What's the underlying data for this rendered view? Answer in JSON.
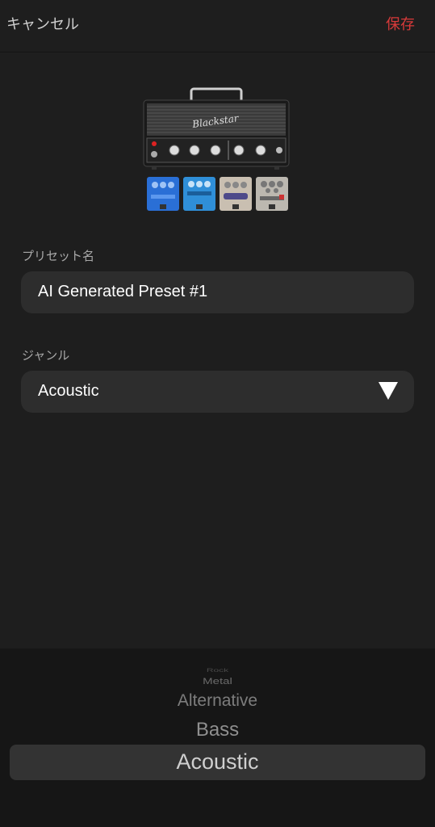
{
  "header": {
    "cancel_label": "キャンセル",
    "save_label": "保存"
  },
  "preset_name": {
    "label": "プリセット名",
    "value": "AI Generated Preset #1"
  },
  "genre": {
    "label": "ジャンル",
    "selected": "Acoustic"
  },
  "picker": {
    "items": [
      "Rock",
      "Metal",
      "Alternative",
      "Bass",
      "Acoustic"
    ]
  },
  "rig": {
    "amp_logo": "Blackstar",
    "pedals": [
      "SUSTAINER",
      "Digital Reverb",
      "SMART ECHO",
      "CLASSIC FLAT"
    ]
  },
  "colors": {
    "background": "#1e1e1e",
    "field": "#2d2d2d",
    "accent_save": "#d83a3a",
    "picker_bg": "#161616"
  }
}
